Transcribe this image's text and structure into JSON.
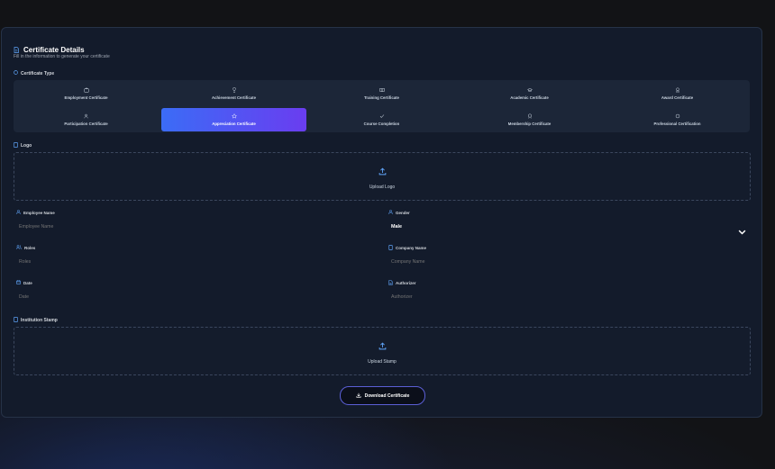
{
  "header": {
    "title": "Certificate Details",
    "subtitle": "Fill in the information to generate your certificate"
  },
  "certificate_type": {
    "label": "Certificate Type",
    "options": [
      {
        "label": "Employment Certificate",
        "icon": "briefcase-icon",
        "selected": false
      },
      {
        "label": "Achievement Certificate",
        "icon": "trophy-icon",
        "selected": false
      },
      {
        "label": "Training Certificate",
        "icon": "book-icon",
        "selected": false
      },
      {
        "label": "Academic Certificate",
        "icon": "graduation-cap-icon",
        "selected": false
      },
      {
        "label": "Award Certificate",
        "icon": "award-icon",
        "selected": false
      },
      {
        "label": "Participation Certificate",
        "icon": "users-icon",
        "selected": false
      },
      {
        "label": "Appreciation Certificate",
        "icon": "star-icon",
        "selected": true
      },
      {
        "label": "Course Completion",
        "icon": "check-icon",
        "selected": false
      },
      {
        "label": "Membership Certificate",
        "icon": "badge-icon",
        "selected": false
      },
      {
        "label": "Professional Certification",
        "icon": "circle-icon",
        "selected": false
      }
    ]
  },
  "logo": {
    "label": "Logo",
    "upload_label": "Upload Logo"
  },
  "fields": {
    "employee_name": {
      "label": "Employee Name",
      "placeholder": "Employee Name",
      "value": ""
    },
    "gender": {
      "label": "Gender",
      "value": "Male"
    },
    "roles": {
      "label": "Roles",
      "placeholder": "Roles",
      "value": ""
    },
    "company_name": {
      "label": "Company Name",
      "placeholder": "Company Name",
      "value": ""
    },
    "date": {
      "label": "Date",
      "placeholder": "Date",
      "value": ""
    },
    "authorizer": {
      "label": "Authorizer",
      "placeholder": "Authorizer",
      "value": ""
    }
  },
  "stamp": {
    "label": "Institution Stamp",
    "upload_label": "Upload Stamp"
  },
  "actions": {
    "download_label": "Download Certificate"
  },
  "colors": {
    "accent_start": "#3b6cf6",
    "accent_end": "#6a3df0",
    "icon_blue": "#60a5fa",
    "panel_bg": "#131b2b"
  }
}
